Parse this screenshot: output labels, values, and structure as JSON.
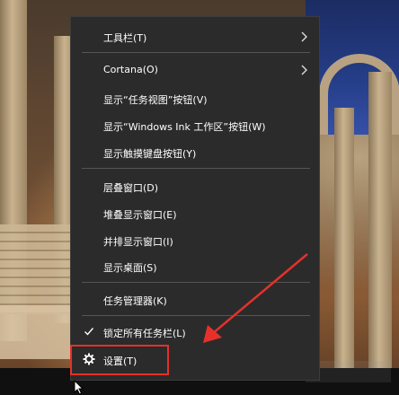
{
  "menu": {
    "items": [
      {
        "label": "工具栏(T)",
        "submenu": true
      },
      {
        "label": "Cortana(O)",
        "submenu": true
      },
      {
        "label": "显示“任务视图”按钮(V)"
      },
      {
        "label": "显示“Windows Ink 工作区”按钮(W)"
      },
      {
        "label": "显示触摸键盘按钮(Y)"
      },
      {
        "label": "层叠窗口(D)"
      },
      {
        "label": "堆叠显示窗口(E)"
      },
      {
        "label": "并排显示窗口(I)"
      },
      {
        "label": "显示桌面(S)"
      },
      {
        "label": "任务管理器(K)"
      },
      {
        "label": "锁定所有任务栏(L)",
        "checked": true
      },
      {
        "label": "设置(T)",
        "icon": "gear-icon"
      }
    ]
  },
  "icons": {
    "submenu": "chevron-right-icon",
    "check": "checkmark-icon",
    "settings": "gear-icon",
    "cursor": "mouse-pointer-icon"
  },
  "colors": {
    "menu_bg": "#2b2b2b",
    "menu_text": "#ffffff",
    "annotation": "#e5312a"
  }
}
